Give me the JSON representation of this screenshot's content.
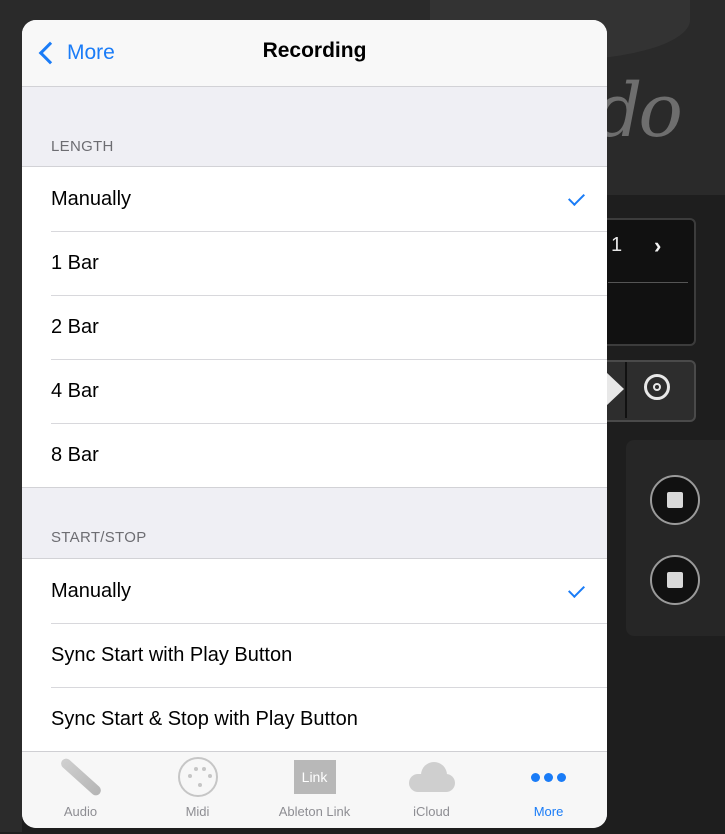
{
  "background": {
    "logo_fragment": "do",
    "bar_number": "1"
  },
  "navbar": {
    "back_label": "More",
    "title": "Recording"
  },
  "length_section": {
    "header": "LENGTH",
    "options": [
      "Manually",
      "1 Bar",
      "2 Bar",
      "4 Bar",
      "8 Bar"
    ],
    "selected": "Manually"
  },
  "startstop_section": {
    "header": "START/STOP",
    "options": [
      "Manually",
      "Sync Start with Play Button",
      "Sync Start & Stop with Play Button"
    ],
    "selected": "Manually"
  },
  "tabbar": {
    "tabs": [
      {
        "label": "Audio",
        "icon": "audio-jack-icon"
      },
      {
        "label": "Midi",
        "icon": "midi-connector-icon"
      },
      {
        "label": "Ableton Link",
        "icon": "link-icon",
        "icon_text": "Link"
      },
      {
        "label": "iCloud",
        "icon": "cloud-icon"
      },
      {
        "label": "More",
        "icon": "more-dots-icon"
      }
    ],
    "active": "More"
  },
  "colors": {
    "accent": "#1a7cf7",
    "group_bg": "#efeff4"
  }
}
